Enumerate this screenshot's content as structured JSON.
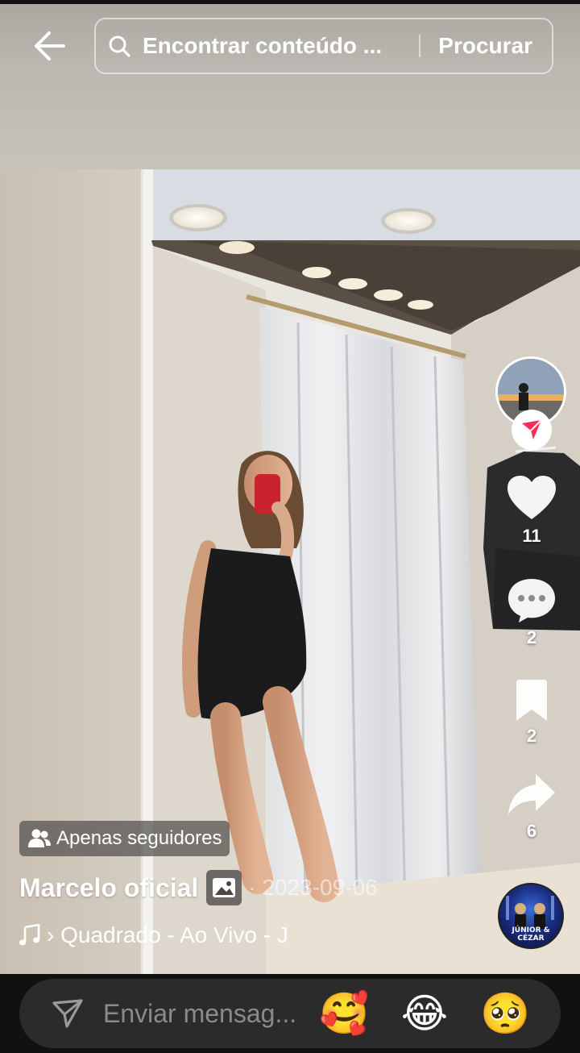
{
  "header": {
    "back_icon": "arrow-left-icon",
    "search_icon": "search-icon",
    "search_placeholder": "Encontrar conteúdo ...",
    "search_button_label": "Procurar"
  },
  "actions": {
    "follow_icon": "send-arrow-icon",
    "like": {
      "icon": "heart-icon",
      "count": "11"
    },
    "comment": {
      "icon": "comment-bubble-icon",
      "count": "2"
    },
    "bookmark": {
      "icon": "bookmark-icon",
      "count": "2"
    },
    "share": {
      "icon": "share-arrow-icon",
      "count": "6"
    }
  },
  "post": {
    "visibility_icon": "people-icon",
    "visibility_label": "Apenas seguidores",
    "author": "Marcelo oficial",
    "photo_icon": "image-icon",
    "date": "· 2023-09-06",
    "music_icon": "music-note-icon",
    "music_text": "› Quadrado - Ao Vivo - J",
    "music_disc_text": "JÚNIOR & CÉZAR"
  },
  "composer": {
    "send_icon": "send-icon",
    "placeholder": "Enviar mensag...",
    "emojis": [
      "🥰",
      "😂",
      "🥺"
    ]
  },
  "colors": {
    "accent": "#fe2c55",
    "bottom_bar": "#111111",
    "message_field": "#2b2b2b"
  }
}
